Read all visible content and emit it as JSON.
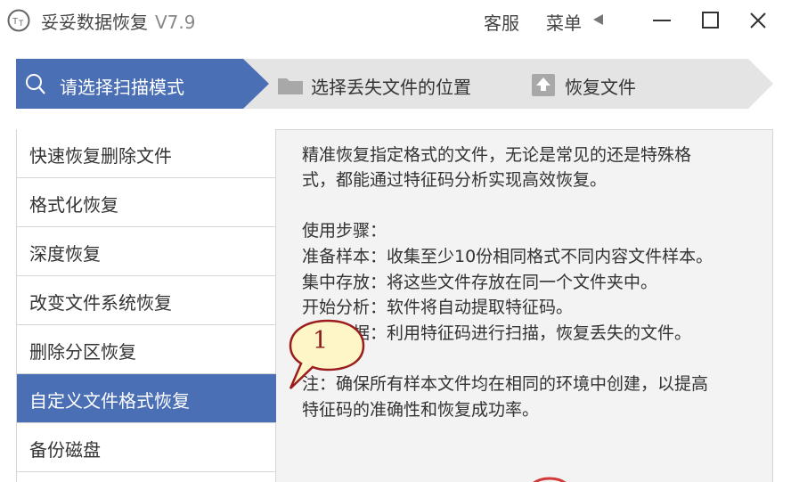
{
  "titlebar": {
    "app_name": "妥妥数据恢复",
    "version": "V7.9",
    "service_label": "客服",
    "menu_label": "菜单"
  },
  "steps": [
    {
      "label": "请选择扫描模式",
      "icon": "search-icon",
      "active": true
    },
    {
      "label": "选择丢失文件的位置",
      "icon": "folder-icon",
      "active": false
    },
    {
      "label": "恢复文件",
      "icon": "upload-icon",
      "active": false
    }
  ],
  "sidebar": {
    "items": [
      {
        "label": "快速恢复删除文件"
      },
      {
        "label": "格式化恢复"
      },
      {
        "label": "深度恢复"
      },
      {
        "label": "改变文件系统恢复"
      },
      {
        "label": "删除分区恢复"
      },
      {
        "label": "自定义文件格式恢复",
        "active": true
      },
      {
        "label": "备份磁盘"
      }
    ]
  },
  "description": {
    "lines": [
      "精准恢复指定格式的文件，无论是常见的还是特殊格",
      "式，都能通过特征码分析实现高效恢复。",
      "使用步骤：",
      "准备样本：收集至少10份相同格式不同内容文件样本。",
      "集中存放：将这些文件存放在同一个文件夹中。",
      "开始分析：软件将自动提取特征码。",
      "扫描数据：利用特征码进行扫描，恢复丢失的文件。",
      "注：确保所有样本文件均在相同的环境中创建，以提高",
      "特征码的准确性和恢复成功率。"
    ]
  },
  "callout": {
    "number": "1"
  },
  "colors": {
    "accent": "#4a6fb5",
    "step_inactive": "#e4e4e4",
    "panel_bg": "#f3f3f3",
    "callout_fill": "#fff6c8",
    "callout_border": "#9a1c1c"
  }
}
